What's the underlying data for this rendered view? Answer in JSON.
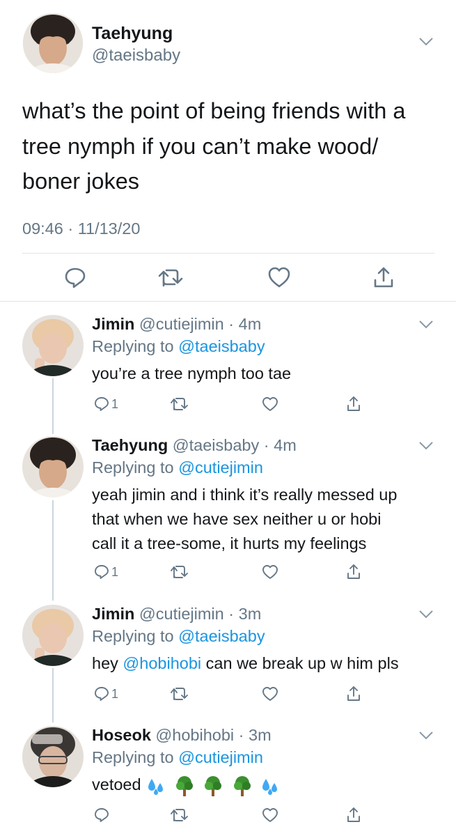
{
  "main_tweet": {
    "name": "Taehyung",
    "handle": "@taeisbaby",
    "text_lines": [
      "what’s the point of being friends with a",
      "tree nymph if you can’t make wood/",
      "boner jokes"
    ],
    "timestamp": "09:46 · 11/13/20",
    "actions": [
      "reply-icon",
      "retweet-icon",
      "like-icon",
      "share-icon"
    ]
  },
  "replies": [
    {
      "name": "Jimin",
      "handle": "@cutiejimin",
      "time": "· 4m",
      "replying_prefix": "Replying to ",
      "replying_to": "@taeisbaby",
      "text_lines": [
        "you’re a tree nymph too tae"
      ],
      "reply_count": "1"
    },
    {
      "name": "Taehyung",
      "handle": "@taeisbaby",
      "time": "· 4m",
      "replying_prefix": "Replying to ",
      "replying_to": "@cutiejimin",
      "text_lines": [
        "yeah jimin and i think it’s really messed up",
        "that when we have sex neither u or hobi",
        "call it a tree-some, it hurts my feelings"
      ],
      "reply_count": "1"
    },
    {
      "name": "Jimin",
      "handle": "@cutiejimin",
      "time": "· 3m",
      "replying_prefix": "Replying to ",
      "replying_to": "@taeisbaby",
      "text_pre": "hey ",
      "text_mention": "@hobihobi",
      "text_post": " can we break up w him pls",
      "reply_count": "1"
    },
    {
      "name": "Hoseok",
      "handle": "@hobihobi",
      "time": "· 3m",
      "replying_prefix": "Replying to ",
      "replying_to": "@cutiejimin",
      "text": "vetoed",
      "emojis": [
        "sweat-droplets-emoji",
        "tree-emoji",
        "tree-emoji",
        "tree-emoji",
        "sweat-droplets-emoji"
      ],
      "reply_count": ""
    }
  ],
  "colors": {
    "link": "#1b95e0",
    "secondary_text": "#657786",
    "divider": "#dfe4e8",
    "thread_line": "#ccd6dd"
  }
}
